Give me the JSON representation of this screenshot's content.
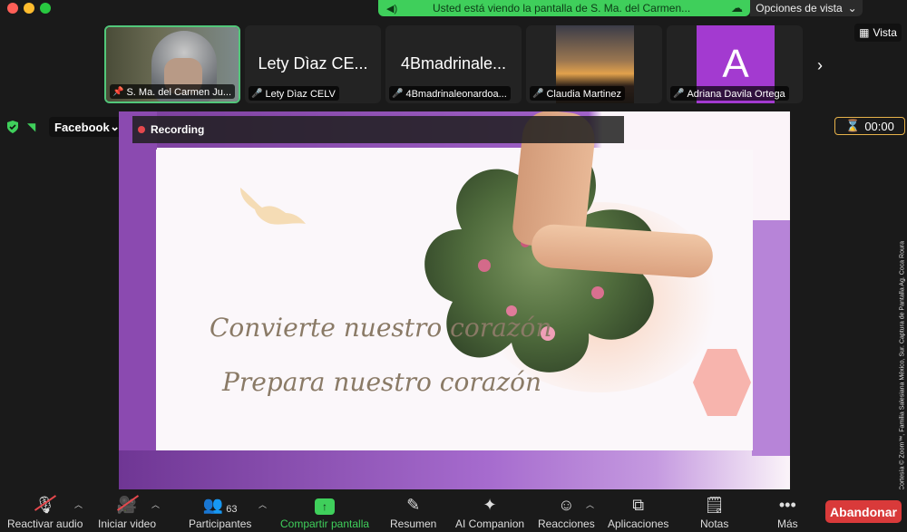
{
  "banner": {
    "text": "Usted está viendo la pantalla de S. Ma. del Carmen...",
    "view_options": "Opciones de vista"
  },
  "participants_strip": [
    {
      "big_name": "",
      "label": "S. Ma. del Carmen Ju...",
      "muted": false,
      "pinned": true
    },
    {
      "big_name": "Lety Dìaz CE...",
      "label": "Lety Dìaz CELV",
      "muted": true
    },
    {
      "big_name": "4Bmadrinale...",
      "label": "4Bmadrinaleonardoa...",
      "muted": true
    },
    {
      "big_name": "",
      "label": "Claudia Martinez",
      "muted": true
    },
    {
      "big_name": "",
      "label": "Adriana Davila Ortega",
      "muted": true,
      "avatar_letter": "A",
      "avatar_color": "#a33ad0"
    }
  ],
  "vista": "Vista",
  "status": {
    "livestream": "Facebook",
    "recording": "Recording",
    "timer": "00:00"
  },
  "slide": {
    "line1": "Convierte nuestro corazón",
    "line2": "Prepara nuestro corazón"
  },
  "credit": "Cortesía © Zoom™, Familia Salesiana México, Sur. Captura de Pantalla Ag. Coca Roura",
  "toolbar": {
    "audio": "Reactivar audio",
    "video": "Iniciar video",
    "participants": "Participantes",
    "participants_count": "63",
    "share": "Compartir pantalla",
    "summary": "Resumen",
    "ai": "AI Companion",
    "reactions": "Reacciones",
    "apps": "Aplicaciones",
    "notes": "Notas",
    "more": "Más",
    "leave": "Abandonar"
  },
  "colors": {
    "share_green": "#3fcf5b",
    "leave_red": "#d93a3a",
    "slide_purple": "#8b4ab0",
    "timer_border": "#e7b24a"
  }
}
